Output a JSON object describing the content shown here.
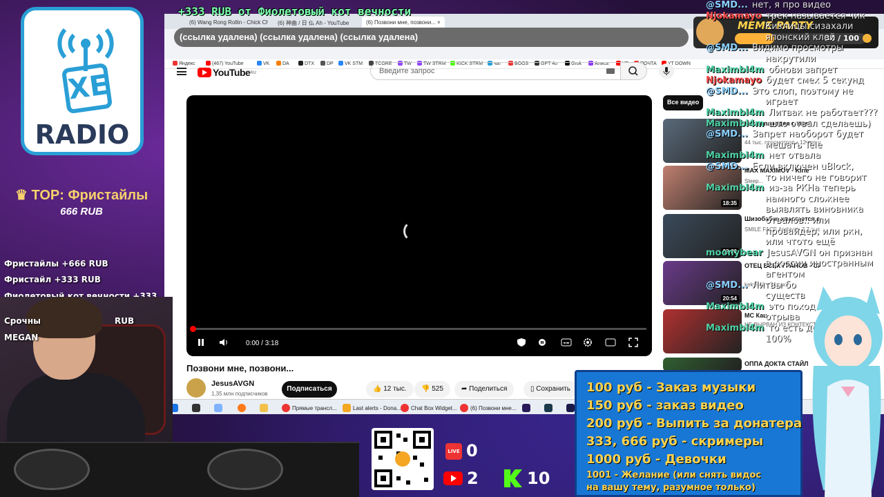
{
  "overlay": {
    "banner": "+333 RUB  от Фиолетовый кот вечности",
    "logo_text": "XE",
    "logo_radio": "RADIO",
    "top_title": "♛ TOP: Фристайлы",
    "top_amount": "666 RUB",
    "donations": [
      "Фристайлы +666 RUB",
      "Фристайл +333 RUB",
      "Фиолетовый кот вечности +333 RUB",
      "Срочны",
      "RUB",
      "MEGAN"
    ],
    "meme_title": "MEME PARTY",
    "meme_count": "30 / 100",
    "meme_progress": 0.3,
    "live_count": "0",
    "yt_count": "2",
    "kick_count": "10",
    "prices": [
      {
        "price": "100 руб",
        "label": " - Заказ музыки"
      },
      {
        "price": "150 руб",
        "label": " - заказ видео"
      },
      {
        "price": "200 руб",
        "label": " - Выпить за донатера"
      },
      {
        "price": "333, 666 руб",
        "label": " - скримеры"
      },
      {
        "price": "1000 руб",
        "label": " - Девочки"
      },
      {
        "price": "1001",
        "label": " - Желание (или снять видос"
      },
      {
        "price": "",
        "label": "на вашу тему, разумное только)"
      }
    ]
  },
  "chat": [
    {
      "user": "@SMD...",
      "text": "нет, я про видео",
      "color": "#8ad0ff"
    },
    {
      "user": "Njokamayo",
      "text": "трек называется чик",
      "color": "#ff4d4d"
    },
    {
      "user": "",
      "text": "Кизлицы сизахали",
      "color": "#ffffff"
    },
    {
      "user": "",
      "text": "японский клей",
      "color": "#ffffff"
    },
    {
      "user": "@SMD...",
      "text": "Видимо просмотры",
      "color": "#8ad0ff"
    },
    {
      "user": "",
      "text": "накрутили",
      "color": "#ffffff"
    },
    {
      "user": "Maximbl4m",
      "text": "обнови запрет",
      "color": "#4fd1a5"
    },
    {
      "user": "Njokamayo",
      "text": "будет смех 5 секунд",
      "color": "#ff4d4d"
    },
    {
      "user": "@SMD...",
      "text": "Это слоп, поэтому не",
      "color": "#8ad0ff"
    },
    {
      "user": "",
      "text": "играет",
      "color": "#ffffff"
    },
    {
      "user": "Maximbl4m",
      "text": "Литвак не работает???",
      "color": "#4fd1a5"
    },
    {
      "user": "Maximbl4m",
      "text": "што отвал сделаешь)",
      "color": "#4fd1a5"
    },
    {
      "user": "@SMD...",
      "text": "Запрет наоборот будет",
      "color": "#8ad0ff"
    },
    {
      "user": "",
      "text": "мешать Tele",
      "color": "#ffffff"
    },
    {
      "user": "Maximbl4m",
      "text": "нет отвала",
      "color": "#4fd1a5"
    },
    {
      "user": "@SMD...",
      "text": "Если включен uBlock,",
      "color": "#8ad0ff"
    },
    {
      "user": "",
      "text": "то ничего не говорит",
      "color": "#ffffff"
    },
    {
      "user": "Maximbl4m",
      "text": "из-за РКНа теперь",
      "color": "#4fd1a5"
    },
    {
      "user": "",
      "text": "намного сложнее",
      "color": "#ffffff"
    },
    {
      "user": "",
      "text": "выявлять виновника",
      "color": "#ffffff"
    },
    {
      "user": "",
      "text": "отвалов.. или",
      "color": "#ffffff"
    },
    {
      "user": "",
      "text": "провайдер, или ркн,",
      "color": "#ffffff"
    },
    {
      "user": "",
      "text": "или чтото ещё",
      "color": "#ffffff"
    },
    {
      "user": "moonybear",
      "text": "JesusAVGN он признан",
      "color": "#4fd1a5"
    },
    {
      "user": "",
      "text": "в россии иностранным",
      "color": "#ffffff"
    },
    {
      "user": "",
      "text": "агентом",
      "color": "#ffffff"
    },
    {
      "user": "@SMD...",
      "text": "Литвы бо",
      "color": "#8ad0ff"
    },
    {
      "user": "",
      "text": "существ",
      "color": "#ffffff"
    },
    {
      "user": "Maximbl4m",
      "text": "это поход",
      "color": "#4fd1a5"
    },
    {
      "user": "",
      "text": "отрыва",
      "color": "#ffffff"
    },
    {
      "user": "Maximbl4m",
      "text": "то есть де",
      "color": "#4fd1a5"
    },
    {
      "user": "",
      "text": "100%",
      "color": "#ffffff"
    }
  ],
  "browser": {
    "tabs": [
      "(6) Wang Rong Rollin - Chick Ch",
      "(6) 神曲 / 日 仏 Ah - YouTube",
      "(6) Позвони мне, позвони... ×"
    ],
    "address": "(ссылка удалена) (ссылка удалена) (ссылка удалена)",
    "bookmarks": [
      "Яндекс",
      "(467) YouTube",
      "VK",
      "DA",
      "DTX",
      "DP",
      "VK STM",
      "TCORE",
      "TW",
      "TW STRM",
      "KICK STRM",
      "чат",
      "BOOS",
      "GPT 4o",
      "Grok",
      "Алиса",
      "YT",
      "ПОЧТА",
      "YT DOWN"
    ]
  },
  "youtube": {
    "logo": "YouTube",
    "region": "RU",
    "search_placeholder": "Введите запрос",
    "time": "0:00 / 3:18",
    "progress": 0.0,
    "title": "Позвони мне, позвони...",
    "channel": "JesusAVGN",
    "subs": "1,35 млн подписчиков",
    "subscribe": "Подписаться",
    "likes": "12 тыс.",
    "dislikes": "525",
    "share": "Поделиться",
    "save": "Сохранить",
    "chip": "Все видео",
    "recs": [
      {
        "title": "Какая пародия с кем?",
        "meta": "44 тыс. просмотров • 12 лет назад",
        "dur": "",
        "color": "#5a6a7a"
      },
      {
        "title": "MAX MAXIMOV - Kirie",
        "meta": "Sleep...",
        "dur": "18:35",
        "color": "#c08070"
      },
      {
        "title": "Шизобабка хвастается едой",
        "meta": "SMILE FACE Archive • 7,7 тыс. просмотров • 5 дней назад",
        "dur": "22:20",
        "color": "#3a4a5a"
      },
      {
        "title": "ОТЕЦ ВСЕХ ГРАНОВ - САШКО ФОКИН",
        "meta": "kekys40 • 74 тыс.",
        "dur": "20:54",
        "color": "#6a3a8a"
      },
      {
        "title": "МС Кац",
        "meta": "НЕ ВЫРВАН ИЗ КОНТЕКСТА",
        "dur": "",
        "color": "#b03030"
      },
      {
        "title": "ОППА ДОКТА СТАЙЛ",
        "meta": "",
        "dur": "",
        "color": "#306030"
      }
    ]
  },
  "taskbar": [
    "Прямые трансл...",
    "Last alerts - Dona...",
    "Chat Box Widget...",
    "(6) Позвони мне..."
  ]
}
